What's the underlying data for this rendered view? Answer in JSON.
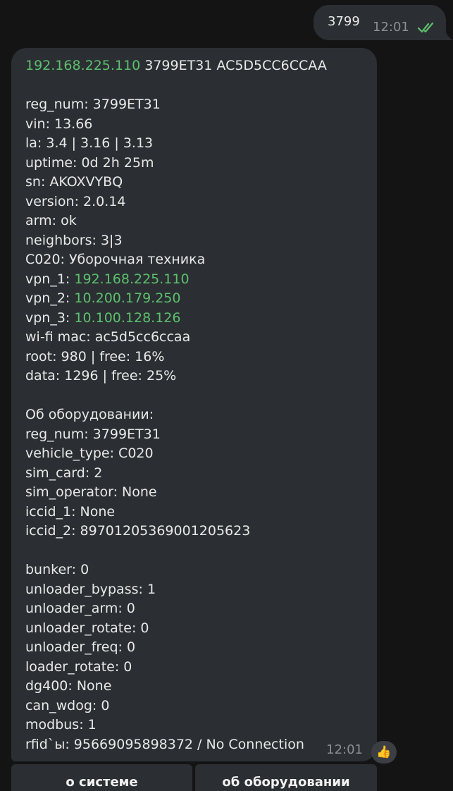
{
  "outgoing": {
    "text": "3799",
    "time": "12:01",
    "status_icon": "double-check-icon",
    "check_color": "#5cc06c"
  },
  "incoming": {
    "header": {
      "ip": "192.168.225.110",
      "rest": " 3799ET31 AC5D5CC6CCAA"
    },
    "system_lines": [
      "reg_num: 3799ET31",
      "vin: 13.66",
      "la: 3.4 | 3.16 | 3.13",
      "uptime: 0d 2h 25m",
      "sn: AKOXVYBQ",
      "version: 2.0.14",
      "arm: ok",
      "neighbors: 3|3",
      "C020: Уборочная техника"
    ],
    "vpn": [
      {
        "label": "vpn_1: ",
        "ip": "192.168.225.110"
      },
      {
        "label": "vpn_2: ",
        "ip": "10.200.179.250"
      },
      {
        "label": "vpn_3: ",
        "ip": "10.100.128.126"
      }
    ],
    "system_lines_2": [
      "wi-fi mac: ac5d5cc6ccaa",
      "root: 980 | free: 16%",
      "data: 1296 | free: 25%"
    ],
    "equipment_lines": [
      "Об оборудовании:",
      "reg_num: 3799ET31",
      "vehicle_type: C020",
      "sim_card: 2",
      "sim_operator: None",
      "iccid_1: None",
      "iccid_2: 89701205369001205623"
    ],
    "sensor_lines": [
      "bunker: 0",
      "unloader_bypass: 1",
      "unloader_arm: 0",
      "unloader_rotate: 0",
      "unloader_freq: 0",
      "loader_rotate: 0",
      "dg400: None",
      "can_wdog: 0",
      "modbus: 1",
      "rfid`ы: 95669095898372 / No Connection"
    ],
    "time": "12:01",
    "reaction": "👍",
    "reaction_icon": "thumbs-up-icon"
  },
  "keyboard": {
    "left_label": "о системе",
    "right_label": "об оборудовании"
  },
  "colors": {
    "background": "#141414",
    "bubble": "#2b2f33",
    "link_green": "#5cc06c",
    "text": "#e8e8e8",
    "time": "#8a8f94"
  }
}
